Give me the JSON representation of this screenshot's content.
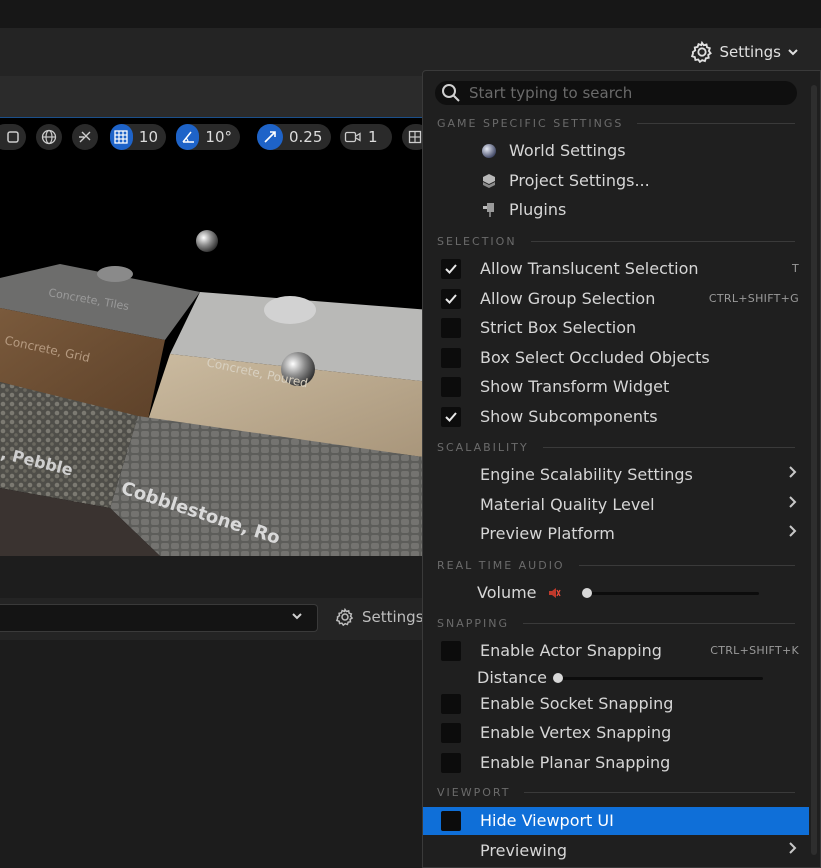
{
  "header": {
    "settings_label": "Settings"
  },
  "viewport_toolbar": {
    "grid_snap": "10",
    "rotation_snap": "10°",
    "scale_snap": "0.25",
    "camera_speed": "1"
  },
  "viewport": {
    "labels": [
      "Concrete, Tiles",
      "Concrete, Grid",
      "Concrete, Poured",
      ", Pebble",
      "Cobblestone, Ro"
    ]
  },
  "lower_panel": {
    "settings_label": "Settings"
  },
  "menu": {
    "search_placeholder": "Start typing to search",
    "game_specific": {
      "title": "GAME SPECIFIC SETTINGS",
      "items": [
        "World Settings",
        "Project Settings...",
        "Plugins"
      ]
    },
    "selection": {
      "title": "SELECTION",
      "items": [
        {
          "label": "Allow Translucent Selection",
          "shortcut": "T",
          "checked": true
        },
        {
          "label": "Allow Group Selection",
          "shortcut": "CTRL+SHIFT+G",
          "checked": true
        },
        {
          "label": "Strict Box Selection",
          "shortcut": "",
          "checked": false
        },
        {
          "label": "Box Select Occluded Objects",
          "shortcut": "",
          "checked": false
        },
        {
          "label": "Show Transform Widget",
          "shortcut": "",
          "checked": false
        },
        {
          "label": "Show Subcomponents",
          "shortcut": "",
          "checked": true
        }
      ]
    },
    "scalability": {
      "title": "SCALABILITY",
      "items": [
        "Engine Scalability Settings",
        "Material Quality Level",
        "Preview Platform"
      ]
    },
    "audio": {
      "title": "REAL TIME AUDIO",
      "volume_label": "Volume",
      "volume_level": 0
    },
    "snapping": {
      "title": "SNAPPING",
      "actor_snapping": {
        "label": "Enable Actor Snapping",
        "shortcut": "CTRL+SHIFT+K",
        "checked": false
      },
      "distance_label": "Distance",
      "distance_level": 0,
      "items": [
        {
          "label": "Enable Socket Snapping",
          "checked": false
        },
        {
          "label": "Enable Vertex Snapping",
          "checked": false
        },
        {
          "label": "Enable Planar Snapping",
          "checked": false
        }
      ]
    },
    "viewport": {
      "title": "VIEWPORT",
      "hide_ui": {
        "label": "Hide Viewport UI",
        "checked": false
      },
      "previewing": "Previewing"
    }
  },
  "colors": {
    "accent": "#0f6fd8",
    "menu_bg": "#1f1f1f",
    "toolbar_blue": "#1e63c8"
  }
}
